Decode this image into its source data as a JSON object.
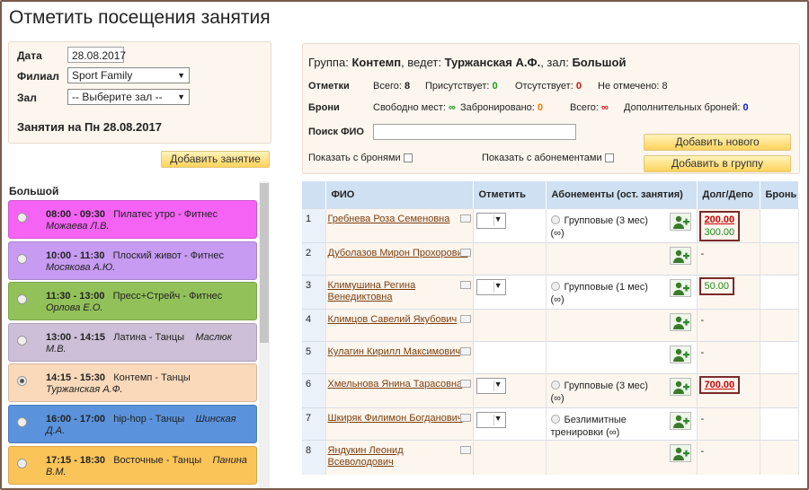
{
  "page_title": "Отметить посещения занятия",
  "filter": {
    "date_label": "Дата",
    "date_value": "28.08.2017",
    "branch_label": "Филиал",
    "branch_value": "Sport Family",
    "hall_label": "Зал",
    "hall_value": "-- Выберите зал --",
    "day_title": "Занятия на Пн 28.08.2017"
  },
  "add_lesson_button": "Добавить занятие",
  "hall_name": "Большой",
  "lessons": [
    {
      "time": "08:00 - 09:30",
      "title": "Пилатес утро - Фитнес",
      "trainer": "Можаева Л.В.",
      "color": "#f563f5",
      "selected": false
    },
    {
      "time": "10:00 - 11:30",
      "title": "Плоский живот - Фитнес",
      "trainer": "Мосякова А.Ю.",
      "color": "#c79bf2",
      "selected": false
    },
    {
      "time": "11:30 - 13:00",
      "title": "Пресс+Стрейч - Фитнес",
      "trainer": "Орлова Е.О.",
      "color": "#92c15a",
      "selected": false
    },
    {
      "time": "13:00 - 14:15",
      "title": "Латина - Танцы",
      "trainer_inline": "Маслюк",
      "trainer": "М.В.",
      "color": "#cdbfd7",
      "selected": false
    },
    {
      "time": "14:15 - 15:30",
      "title": "Контемп - Танцы",
      "trainer": "Туржанская А.Ф.",
      "color": "#fad9bb",
      "selected": true
    },
    {
      "time": "16:00 - 17:00",
      "title": "hip-hop - Танцы",
      "trainer_inline": "Шинская",
      "trainer": "Д.А.",
      "color": "#5a93dc",
      "selected": false
    },
    {
      "time": "17:15 - 18:30",
      "title": "Восточные - Танцы",
      "trainer_inline": "Панина",
      "trainer": "В.М.",
      "color": "#fbc459",
      "selected": false
    }
  ],
  "info": {
    "group_prefix": "Группа:",
    "group_name": "Контемп",
    "trainer_prefix": ", ведет:",
    "trainer_name": "Туржанская А.Ф.",
    "hall_prefix": ", зал:",
    "hall_name": "Большой",
    "marks_label": "Отметки",
    "marks_total_label": "Всего:",
    "marks_total": "8",
    "present_label": "Присутствует:",
    "present": "0",
    "absent_label": "Отсутствует:",
    "absent": "0",
    "unmarked_label": "Не отмечено:",
    "unmarked": "8",
    "bookings_label": "Брони",
    "free_label": "Свободно мест:",
    "free": "∞",
    "booked_label": "Забронировано:",
    "booked": "0",
    "bookings_total_label": "Всего:",
    "bookings_total": "∞",
    "extra_label": "Дополнительных броней:",
    "extra": "0",
    "search_label": "Поиск ФИО",
    "search_value": "",
    "show_bookings": "Показать с бронями",
    "show_subscriptions": "Показать с абонементами",
    "add_new_button": "Добавить нового",
    "add_to_group_button": "Добавить в группу"
  },
  "table": {
    "headers": [
      "",
      "ФИО",
      "Отметить",
      "Абонементы (ост. занятия)",
      "Долг/Депо",
      "Бронь"
    ],
    "rows": [
      {
        "num": "1",
        "name": "Гребнева Роза Семеновна",
        "has_select": true,
        "subscription": "Групповые (3 мес)",
        "sub_rest": "(∞)",
        "debt": "200.00",
        "deposit": "300.00"
      },
      {
        "num": "2",
        "name": "Дуболазов Мирон Прохорович",
        "has_select": false,
        "subscription": "",
        "sub_rest": "",
        "dash": "-"
      },
      {
        "num": "3",
        "name": "Климушина Регина Венедиктовна",
        "has_select": true,
        "subscription": "Групповые (1 мес)",
        "sub_rest": "(∞)",
        "deposit": "50.00"
      },
      {
        "num": "4",
        "name": "Климцов Савелий Якубович",
        "has_select": false,
        "subscription": "",
        "sub_rest": "",
        "dash": "-"
      },
      {
        "num": "5",
        "name": "Кулагин Кирилл Максимович",
        "has_select": false,
        "subscription": "",
        "sub_rest": "",
        "dash": "-"
      },
      {
        "num": "6",
        "name": "Хмельнова Янина Тарасовна",
        "has_select": true,
        "subscription": "Групповые (3 мес)",
        "sub_rest": "(∞)",
        "debt": "700.00"
      },
      {
        "num": "7",
        "name": "Шкиряк Филимон Богданович",
        "has_select": true,
        "subscription": "Безлимитные тренировки (∞)",
        "sub_rest": "",
        "dash": "-"
      },
      {
        "num": "8",
        "name": "Яндукин Леонид Всеволодович",
        "has_select": false,
        "subscription": "",
        "sub_rest": "",
        "dash": "-"
      }
    ]
  }
}
